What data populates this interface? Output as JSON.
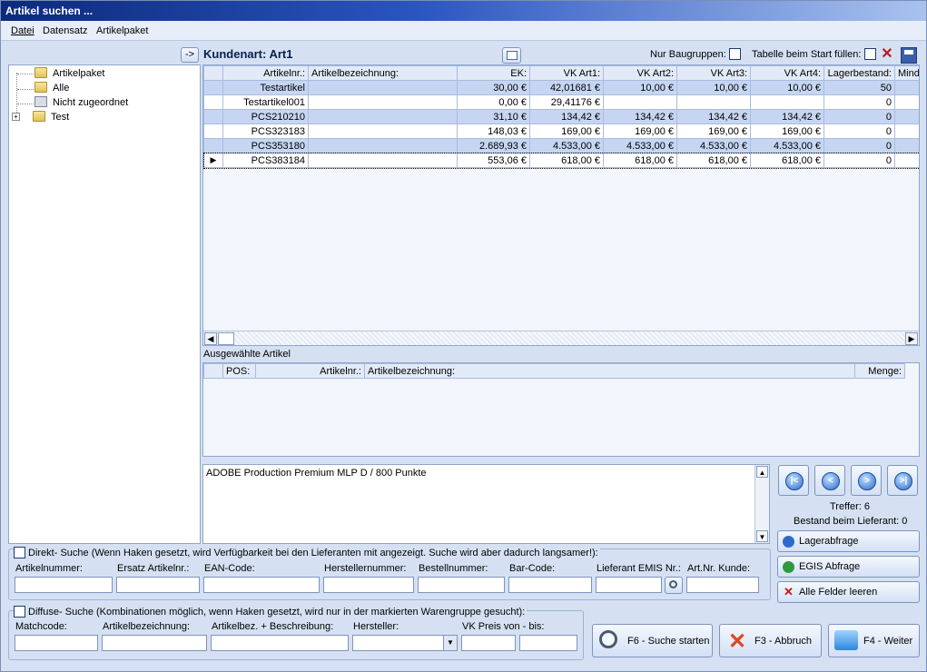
{
  "window": {
    "title": "Artikel suchen ..."
  },
  "menu": [
    "Datei",
    "Datensatz",
    "Artikelpaket"
  ],
  "left": {
    "collapse_label": "->",
    "tree": [
      {
        "label": "Artikelpaket",
        "icon": "package-icon"
      },
      {
        "label": "Alle",
        "icon": "all-icon"
      },
      {
        "label": "Nicht zugeordnet",
        "icon": "document-icon"
      },
      {
        "label": "Test",
        "icon": "folder-icon",
        "expander": "+"
      }
    ]
  },
  "header": {
    "title": "Kundenart: Art1",
    "nur_baugruppen": "Nur Baugruppen:",
    "tabelle_fuellen": "Tabelle beim Start füllen:"
  },
  "grid": {
    "columns": [
      "Artikelnr.:",
      "Artikelbezeichnung:",
      "EK:",
      "VK Art1:",
      "VK Art2:",
      "VK Art3:",
      "VK Art4:",
      "Lagerbestand:",
      "Mind"
    ],
    "rows": [
      [
        "Testartikel",
        "",
        "30,00 €",
        "42,01681 €",
        "10,00 €",
        "10,00 €",
        "10,00 €",
        "50",
        ""
      ],
      [
        "Testartikel001",
        "",
        "0,00 €",
        "29,41176 €",
        "",
        "",
        "",
        "0",
        ""
      ],
      [
        "PCS210210",
        "",
        "31,10 €",
        "134,42 €",
        "134,42 €",
        "134,42 €",
        "134,42 €",
        "0",
        ""
      ],
      [
        "PCS323183",
        "",
        "148,03 €",
        "169,00 €",
        "169,00 €",
        "169,00 €",
        "169,00 €",
        "0",
        ""
      ],
      [
        "PCS353180",
        "",
        "2.689,93 €",
        "4.533,00 €",
        "4.533,00 €",
        "4.533,00 €",
        "4.533,00 €",
        "0",
        ""
      ],
      [
        "PCS383184",
        "",
        "553,06 €",
        "618,00 €",
        "618,00 €",
        "618,00 €",
        "618,00 €",
        "0",
        ""
      ]
    ],
    "current_row_marker": "▶"
  },
  "selected": {
    "caption": "Ausgewählte Artikel",
    "columns": [
      "POS:",
      "Artikelnr.:",
      "Artikelbezeichnung:",
      "Menge:"
    ]
  },
  "description": {
    "text": "ADOBE Production Premium MLP D / 800 Punkte"
  },
  "nav": {
    "treffer": "Treffer: 6",
    "bestand": "Bestand beim Lieferant: 0"
  },
  "side_buttons": {
    "lager": "Lagerabfrage",
    "egis": "EGIS Abfrage",
    "clear": "Alle Felder leeren"
  },
  "direkt": {
    "caption": "Direkt- Suche (Wenn Haken gesetzt, wird Verfügbarkeit bei den Lieferanten mit angezeigt. Suche wird aber dadurch langsamer!):",
    "labels": [
      "Artikelnummer:",
      "Ersatz Artikelnr.:",
      "EAN-Code:",
      "Herstellernummer:",
      "Bestellnummer:",
      "Bar-Code:",
      "Lieferant EMIS Nr.:",
      "Art.Nr. Kunde:"
    ]
  },
  "diffus": {
    "caption": "Diffuse- Suche (Kombinationen möglich, wenn Haken gesetzt, wird nur in der markierten Warengruppe gesucht):",
    "labels": [
      "Matchcode:",
      "Artikelbezeichnung:",
      "Artikelbez. + Beschreibung:",
      "Hersteller:",
      "VK Preis von - bis:"
    ]
  },
  "actions": {
    "search": "F6 - Suche starten",
    "cancel": "F3 - Abbruch",
    "next": "F4 - Weiter"
  }
}
